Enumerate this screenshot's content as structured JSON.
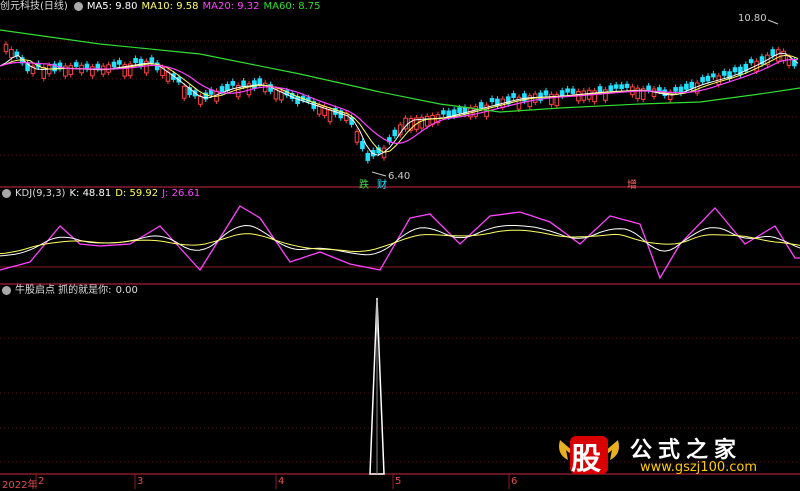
{
  "header": {
    "title": "创元科技(日线)",
    "ma5": "MA5: 9.80",
    "ma10": "MA10: 9.58",
    "ma20": "MA20: 9.32",
    "ma60": "MA60: 8.75"
  },
  "price_panel": {
    "high_label": "10.80",
    "low_label": "6.40",
    "marker_fall": "跌",
    "marker_wealth": "财",
    "marker_add": "增"
  },
  "kdj": {
    "title": "KDJ(9,3,3)",
    "k": "K: 48.81",
    "d": "D: 59.92",
    "j": "J: 26.61"
  },
  "signal": {
    "title": "牛股启点 抓的就是你:",
    "value": "0.00"
  },
  "axis": {
    "labels": [
      "2022年",
      "2",
      "3",
      "4",
      "5",
      "6"
    ]
  },
  "watermark": {
    "glyph": "股",
    "name": "公式之家",
    "url": "www.gszj100.com"
  },
  "colors": {
    "ma5": "#ffffff",
    "ma10": "#ffff66",
    "ma20": "#ff44ff",
    "ma60": "#33dd33",
    "up": "#ff4444",
    "down": "#22e0ff",
    "divider": "#8b1a2a",
    "signal": "#ffffff"
  }
}
